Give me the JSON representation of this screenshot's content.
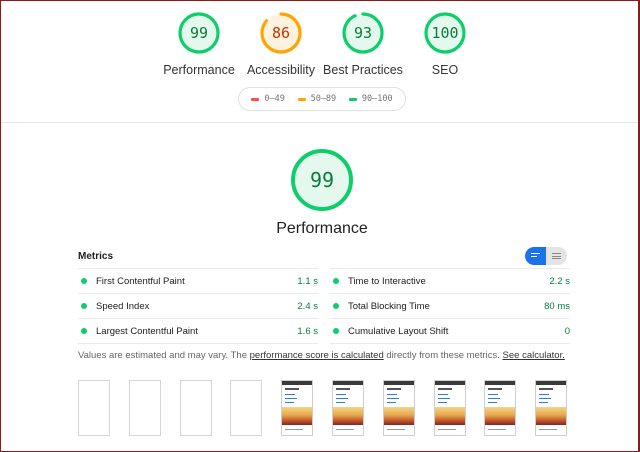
{
  "colors": {
    "pass": "#0cce6b",
    "average": "#ffa400",
    "fail": "#ff4e42",
    "pass_text": "#0a7c39",
    "average_text": "#c33300",
    "accent": "#1a73e8"
  },
  "categories": [
    {
      "score": "99",
      "label": "Performance",
      "status": "pass",
      "fraction": 0.99
    },
    {
      "score": "86",
      "label": "Accessibility",
      "status": "average",
      "fraction": 0.86
    },
    {
      "score": "93",
      "label": "Best Practices",
      "status": "pass",
      "fraction": 0.93
    },
    {
      "score": "100",
      "label": "SEO",
      "status": "pass",
      "fraction": 1.0
    }
  ],
  "legend": [
    {
      "range": "0–49",
      "status": "fail"
    },
    {
      "range": "50–89",
      "status": "average"
    },
    {
      "range": "90–100",
      "status": "pass"
    }
  ],
  "performance": {
    "score": "99",
    "title": "Performance",
    "fraction": 0.99
  },
  "metrics": {
    "header": "Metrics",
    "left": [
      {
        "name": "First Contentful Paint",
        "value": "1.1 s"
      },
      {
        "name": "Speed Index",
        "value": "2.4 s"
      },
      {
        "name": "Largest Contentful Paint",
        "value": "1.6 s"
      }
    ],
    "right": [
      {
        "name": "Time to Interactive",
        "value": "2.2 s"
      },
      {
        "name": "Total Blocking Time",
        "value": "80 ms"
      },
      {
        "name": "Cumulative Layout Shift",
        "value": "0"
      }
    ]
  },
  "note": {
    "prefix": "Values are estimated and may vary. The ",
    "link1": "performance score is calculated",
    "middle": " directly from these metrics. ",
    "link2": "See calculator."
  },
  "filmstrip": [
    {
      "state": "blank"
    },
    {
      "state": "blank"
    },
    {
      "state": "blank"
    },
    {
      "state": "blank"
    },
    {
      "state": "loaded"
    },
    {
      "state": "loaded"
    },
    {
      "state": "loaded"
    },
    {
      "state": "loaded"
    },
    {
      "state": "loaded"
    },
    {
      "state": "loaded"
    }
  ]
}
